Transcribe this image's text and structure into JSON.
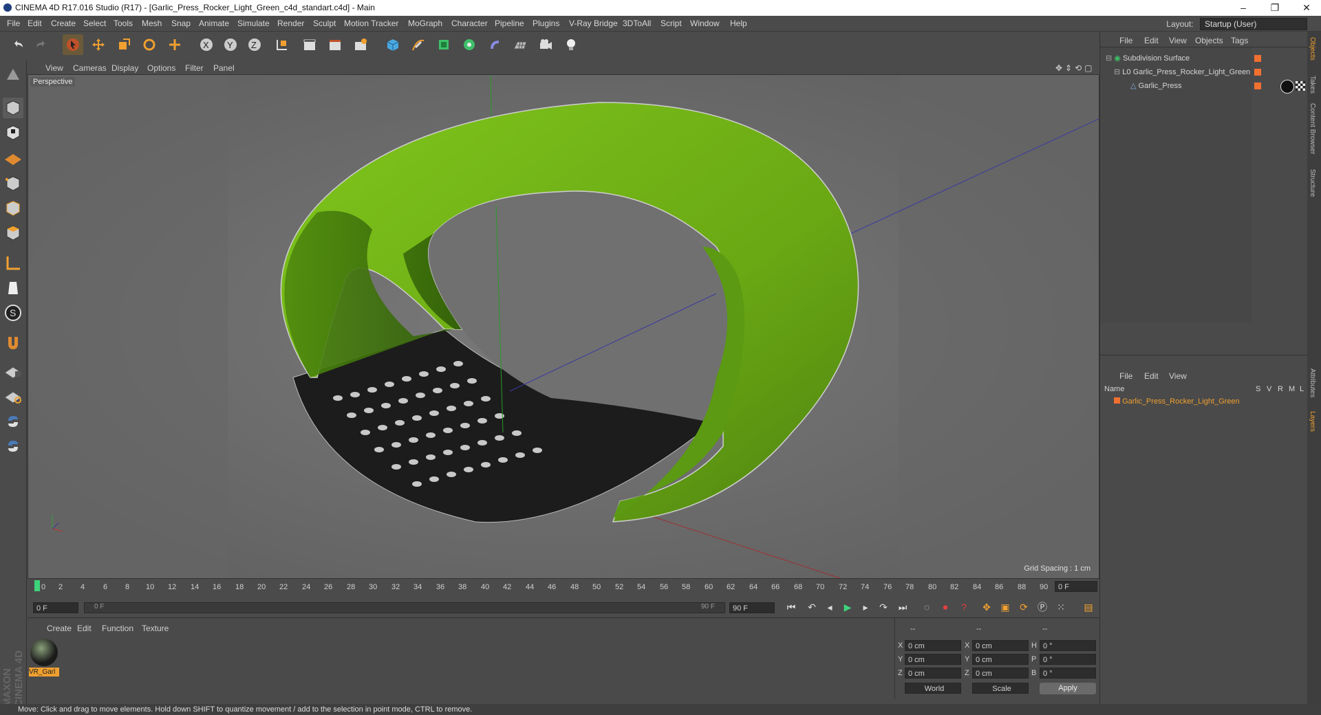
{
  "window": {
    "title": "CINEMA 4D R17.016 Studio (R17) - [Garlic_Press_Rocker_Light_Green_c4d_standart.c4d] - Main"
  },
  "menubar": [
    "File",
    "Edit",
    "Create",
    "Select",
    "Tools",
    "Mesh",
    "Snap",
    "Animate",
    "Simulate",
    "Render",
    "Sculpt",
    "Motion Tracker",
    "MoGraph",
    "Character",
    "Pipeline",
    "Plugins",
    "V-Ray Bridge",
    "3DToAll",
    "Script",
    "Window",
    "Help"
  ],
  "layout": {
    "label": "Layout:",
    "value": "Startup (User)"
  },
  "viewport": {
    "menu": [
      "View",
      "Cameras",
      "Display",
      "Options",
      "Filter",
      "Panel"
    ],
    "label": "Perspective",
    "grid_spacing": "Grid Spacing : 1 cm"
  },
  "timeline": {
    "ticks": [
      "0",
      "2",
      "4",
      "6",
      "8",
      "10",
      "12",
      "14",
      "16",
      "18",
      "20",
      "22",
      "24",
      "26",
      "28",
      "30",
      "32",
      "34",
      "36",
      "38",
      "40",
      "42",
      "44",
      "46",
      "48",
      "50",
      "52",
      "54",
      "56",
      "58",
      "60",
      "62",
      "64",
      "66",
      "68",
      "70",
      "72",
      "74",
      "76",
      "78",
      "80",
      "82",
      "84",
      "86",
      "88",
      "90"
    ],
    "frame_end_field": "0 F",
    "current": "0 F",
    "slider_start": "0 F",
    "slider_end": "90 F",
    "max": "90 F"
  },
  "material_panel": {
    "menu": [
      "Create",
      "Edit",
      "Function",
      "Texture"
    ],
    "material_name": "VR_Garl"
  },
  "coords": {
    "header": [
      "--",
      "--",
      "--"
    ],
    "rows": [
      {
        "a": "X",
        "av": "0 cm",
        "b": "X",
        "bv": "0 cm",
        "c": "H",
        "cv": "0 °"
      },
      {
        "a": "Y",
        "av": "0 cm",
        "b": "Y",
        "bv": "0 cm",
        "c": "P",
        "cv": "0 °"
      },
      {
        "a": "Z",
        "av": "0 cm",
        "b": "Z",
        "bv": "0 cm",
        "c": "B",
        "cv": "0 °"
      }
    ],
    "world": "World",
    "scale": "Scale",
    "apply": "Apply"
  },
  "object_manager": {
    "menu": [
      "File",
      "Edit",
      "View",
      "Objects",
      "Tags"
    ],
    "items": [
      "Subdivision Surface",
      "Garlic_Press_Rocker_Light_Green",
      "Garlic_Press"
    ]
  },
  "layer_manager": {
    "menu": [
      "File",
      "Edit",
      "View"
    ],
    "col_name": "Name",
    "cols": [
      "S",
      "V",
      "R",
      "M",
      "L"
    ],
    "layer": "Garlic_Press_Rocker_Light_Green"
  },
  "side_tabs": [
    "Objects",
    "Takes",
    "Content Browser",
    "Structure",
    "Attributes",
    "Layers"
  ],
  "status": "Move: Click and drag to move elements. Hold down SHIFT to quantize movement / add to the selection in point mode, CTRL to remove.",
  "brand": "MAXON CINEMA 4D"
}
